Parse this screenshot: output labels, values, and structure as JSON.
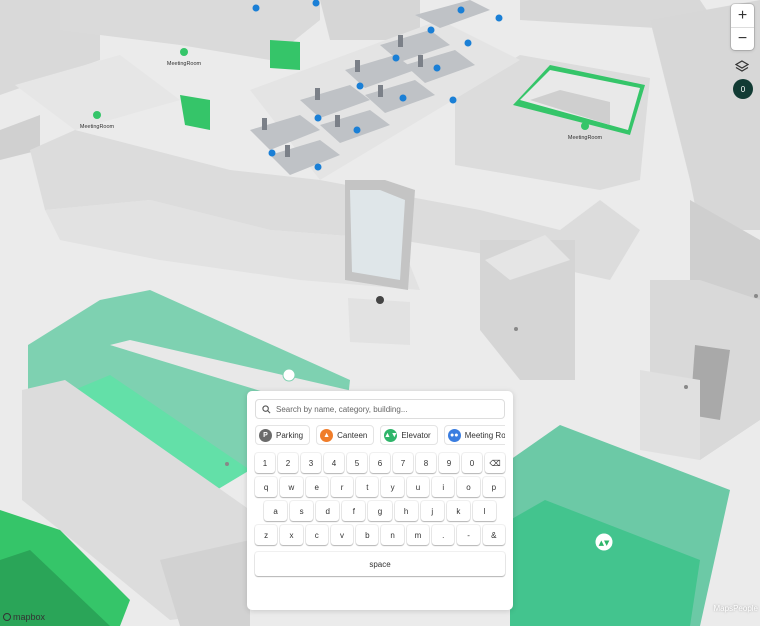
{
  "map": {
    "room_labels": [
      "MeetingRoom",
      "MeetingRoom",
      "MeetingRoom"
    ],
    "colors": {
      "floor": "#ebebeb",
      "wall": "#dcdcdc",
      "wall_side": "#c8c8c8",
      "green_room": "#35c569",
      "mint_area": "#7ed1b1",
      "marker_blue": "#1a7fd6"
    }
  },
  "controls": {
    "zoom_in": "+",
    "zoom_out": "−",
    "floor_badge": "0"
  },
  "attribution": {
    "logo": "mapbox",
    "credit": "MapsPeople"
  },
  "search": {
    "placeholder": "Search by name, category, building..."
  },
  "categories": [
    {
      "label": "Parking",
      "icon": "parking-icon",
      "color": "#6b6b6b",
      "glyph": "P"
    },
    {
      "label": "Canteen",
      "icon": "canteen-icon",
      "color": "#f07d2a",
      "glyph": "▲"
    },
    {
      "label": "Elevator",
      "icon": "elevator-icon",
      "color": "#2fb56a",
      "glyph": "▲▼"
    },
    {
      "label": "Meeting Roo",
      "icon": "meeting-room-icon",
      "color": "#3a7de0",
      "glyph": "●●"
    }
  ],
  "keyboard": {
    "row1": [
      "1",
      "2",
      "3",
      "4",
      "5",
      "6",
      "7",
      "8",
      "9",
      "0",
      "⌫"
    ],
    "row2": [
      "q",
      "w",
      "e",
      "r",
      "t",
      "y",
      "u",
      "i",
      "o",
      "p"
    ],
    "row3": [
      "a",
      "s",
      "d",
      "f",
      "g",
      "h",
      "j",
      "k",
      "l"
    ],
    "row4": [
      "z",
      "x",
      "c",
      "v",
      "b",
      "n",
      "m",
      ".",
      "-",
      "&"
    ],
    "space": "space"
  }
}
